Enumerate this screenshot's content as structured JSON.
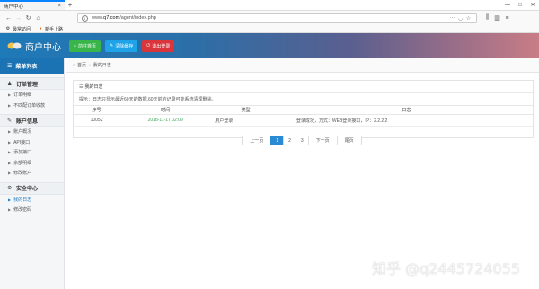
{
  "browser": {
    "tab_title": "商户中心",
    "url_domain": "q7.com",
    "url_prefix": "www.",
    "url_path": "/agent/index.php",
    "bookmarks": [
      "最常访问",
      "新手上路"
    ]
  },
  "header": {
    "brand": "商户中心",
    "buttons": [
      {
        "label": "前往首页",
        "color": "#39b54a"
      },
      {
        "label": "清除缓存",
        "color": "#1fa3e8"
      },
      {
        "label": "退出登录",
        "color": "#d9353b"
      }
    ]
  },
  "sidebar": {
    "title": "菜单列表",
    "groups": [
      {
        "title": "订单管理",
        "items": [
          "订单明细",
          "不匹配订单收款"
        ]
      },
      {
        "title": "账户信息",
        "items": [
          "账户概况",
          "API接口",
          "添加接口",
          "余额明细",
          "修改账户"
        ]
      },
      {
        "title": "安全中心",
        "items": [
          "我的日志",
          "修改密码"
        ]
      }
    ]
  },
  "breadcrumb": {
    "home": "首页",
    "current": "我的日志"
  },
  "panel": {
    "title": "我的日志",
    "tip": "提示：日志只显示最近60天的数据,60天前的记录可能系统清理删除。",
    "columns": [
      "序号",
      "时间",
      "类型",
      "日志"
    ],
    "rows": [
      {
        "id": "10052",
        "time": "2018-11-17 02:09",
        "type": "用户登录",
        "log": "登录成功，方式：WEB登录接口，IP：2.2.2.2"
      }
    ]
  },
  "pagination": {
    "prev": "上一页",
    "pages": [
      "1",
      "2",
      "3"
    ],
    "current": "1",
    "next": "下一页",
    "last": "尾页"
  },
  "watermark": "知乎 @q2445724055"
}
